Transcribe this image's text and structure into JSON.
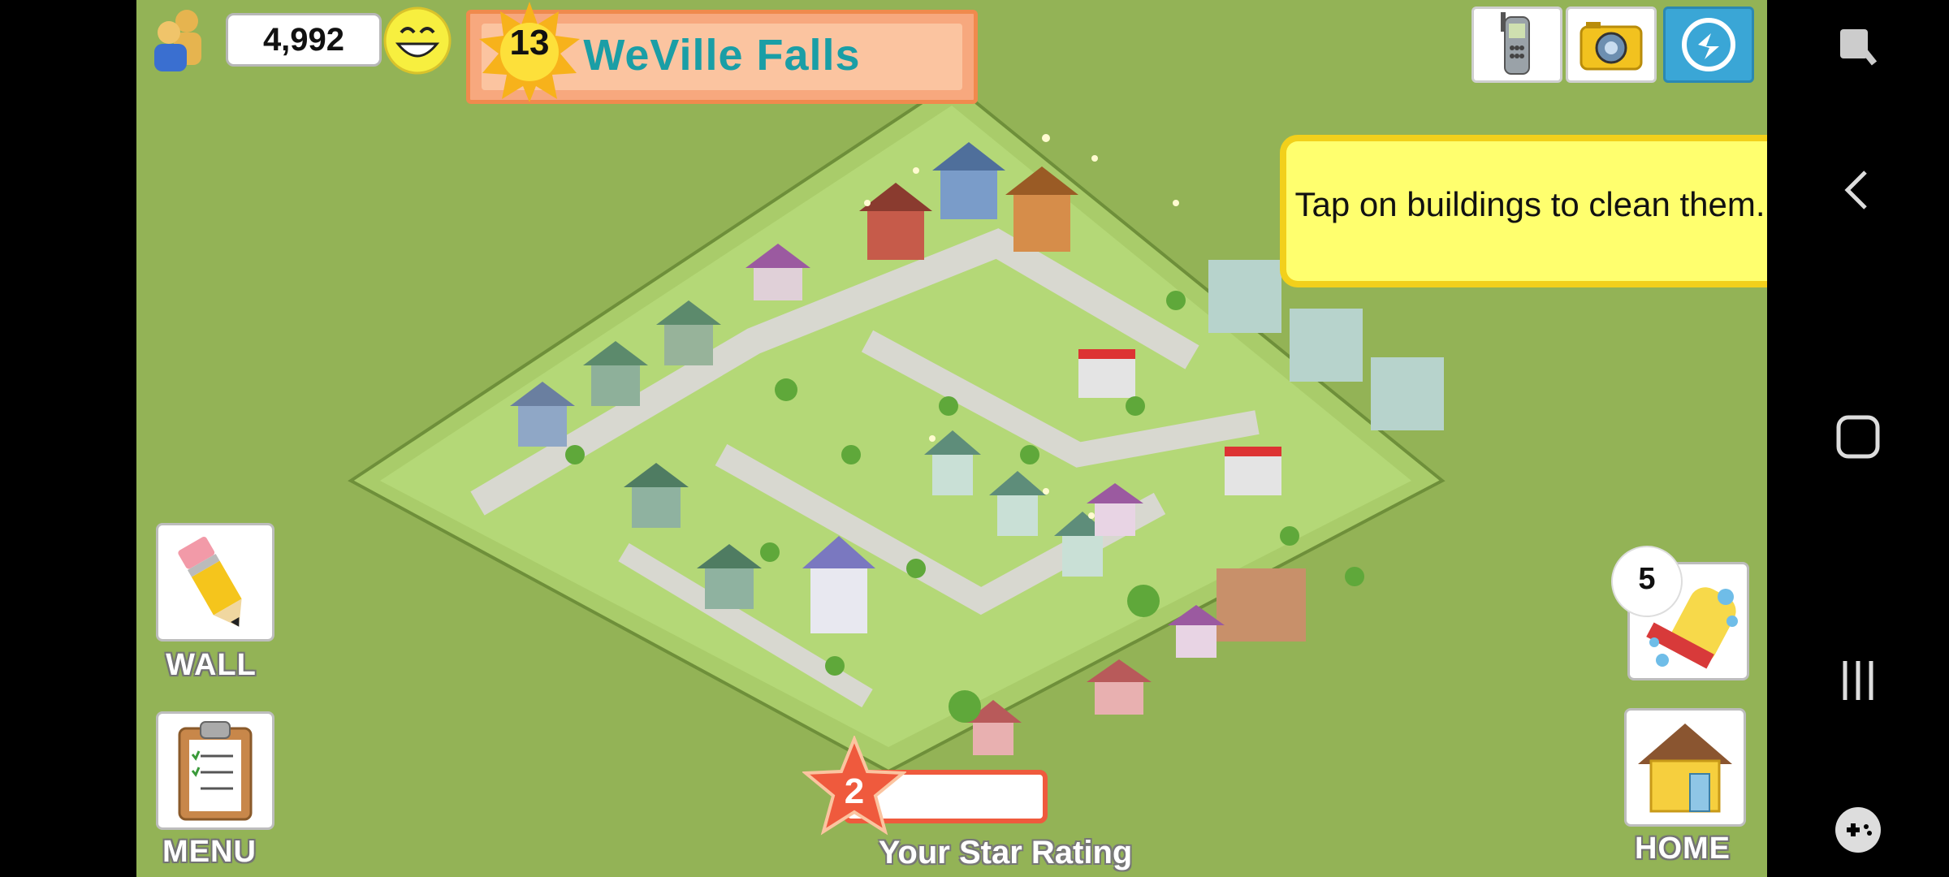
{
  "hud": {
    "population": "4,992",
    "level": "13",
    "town_name": "WeVille Falls"
  },
  "tooltip": {
    "text": "Tap on buildings to clean them."
  },
  "left_buttons": {
    "wall_label": "WALL",
    "menu_label": "MENU"
  },
  "right_buttons": {
    "clean_count": "5",
    "home_label": "HOME"
  },
  "star_rating": {
    "value": "2",
    "label": "Your Star Rating",
    "progress": 0
  },
  "top_buttons": [
    "phone-icon",
    "camera-icon",
    "share-icon"
  ],
  "navbar": [
    "screenshot-edit-icon",
    "back-icon",
    "home-circle-icon",
    "recent-apps-icon",
    "game-tools-icon"
  ],
  "colors": {
    "grass": "#93b356",
    "banner": "#f7a87e",
    "title": "#1a9ea6",
    "tooltip": "#ffff6e",
    "star": "#ef5a3d"
  }
}
